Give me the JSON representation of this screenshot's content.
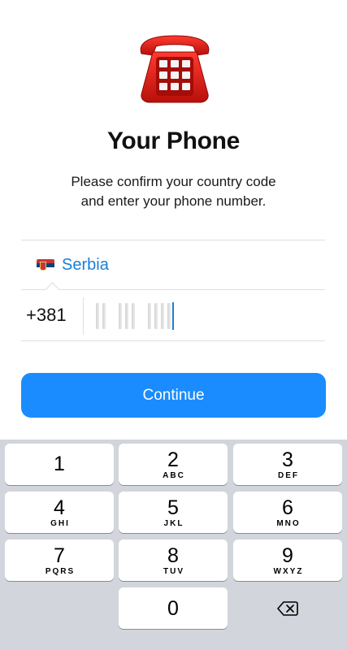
{
  "header": {
    "illustration_icon": "red-telephone-icon",
    "title": "Your Phone",
    "subtitle_line1": "Please confirm your country code",
    "subtitle_line2": "and enter your phone number."
  },
  "country": {
    "flag_icon": "serbia-flag-icon",
    "flag_colors": [
      "#c6363c",
      "#0c4077",
      "#ffffff"
    ],
    "name": "Serbia"
  },
  "phone": {
    "country_code": "+381",
    "number_value": ""
  },
  "actions": {
    "continue_label": "Continue",
    "accent_color": "#1a8cff"
  },
  "keyboard": {
    "keys": [
      {
        "digit": "1",
        "letters": ""
      },
      {
        "digit": "2",
        "letters": "ABC"
      },
      {
        "digit": "3",
        "letters": "DEF"
      },
      {
        "digit": "4",
        "letters": "GHI"
      },
      {
        "digit": "5",
        "letters": "JKL"
      },
      {
        "digit": "6",
        "letters": "MNO"
      },
      {
        "digit": "7",
        "letters": "PQRS"
      },
      {
        "digit": "8",
        "letters": "TUV"
      },
      {
        "digit": "9",
        "letters": "WXYZ"
      },
      {
        "digit": "0",
        "letters": ""
      }
    ],
    "delete_icon": "backspace-icon"
  }
}
